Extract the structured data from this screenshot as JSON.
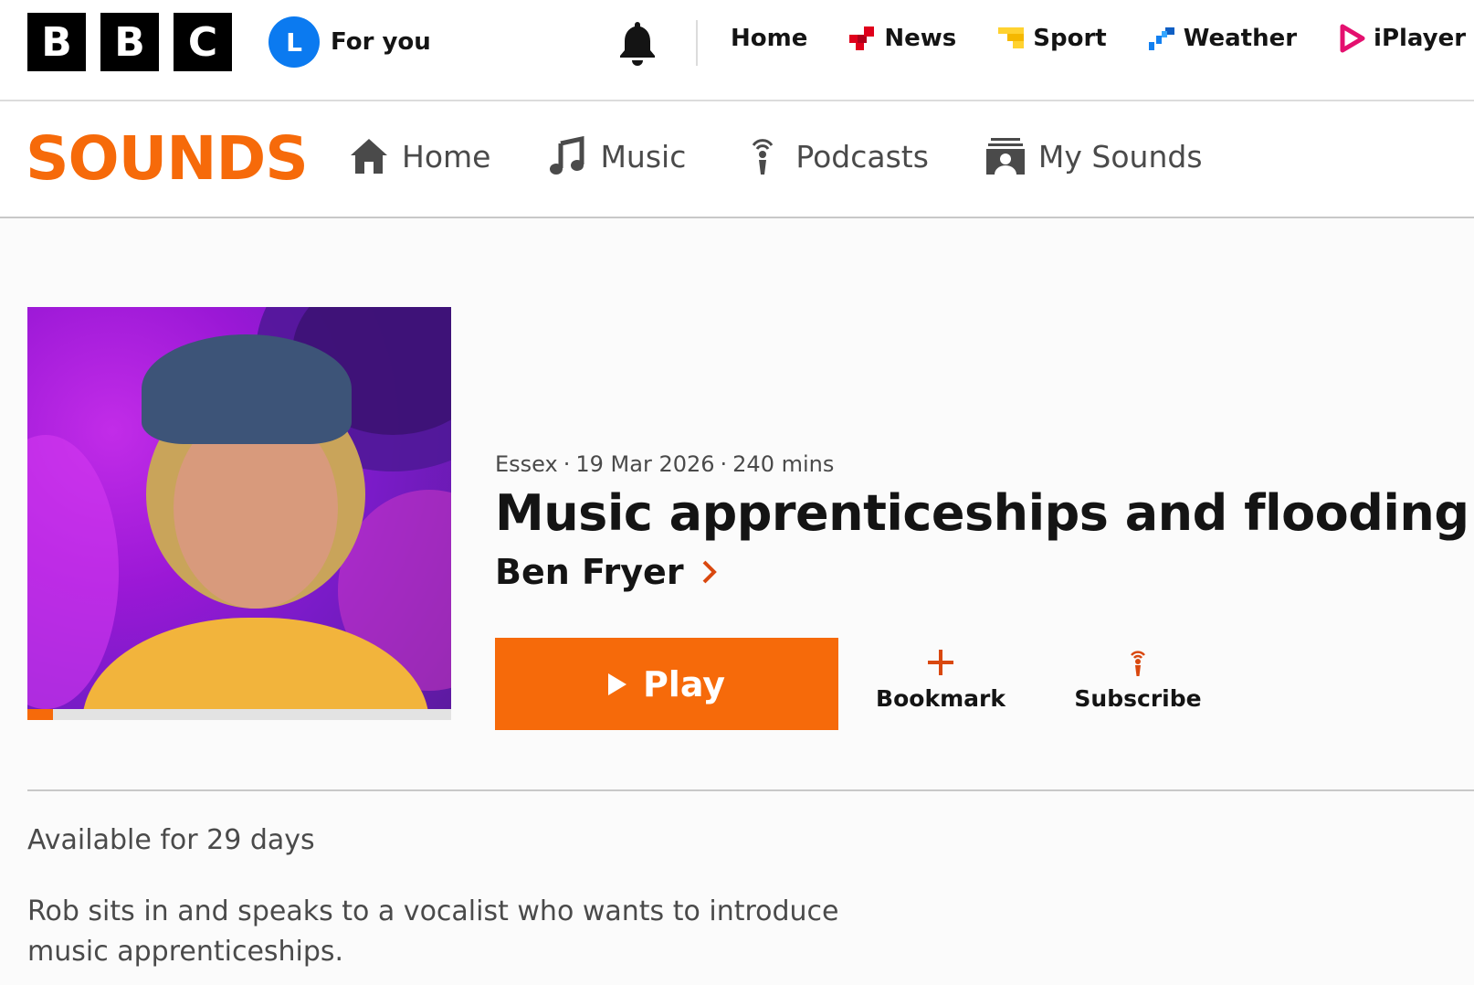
{
  "masthead": {
    "logo_letters": [
      "B",
      "B",
      "C"
    ],
    "account": {
      "initial": "L",
      "label": "For you",
      "avatar_color": "#0b7af0"
    },
    "notifications_icon": "bell-icon",
    "nav": [
      {
        "label": "Home",
        "icon": ""
      },
      {
        "label": "News",
        "icon": "news-icon",
        "color": "#e0001b"
      },
      {
        "label": "Sport",
        "icon": "sport-icon",
        "color": "#ffd230"
      },
      {
        "label": "Weather",
        "icon": "weather-icon",
        "color": "#1380f0"
      },
      {
        "label": "iPlayer",
        "icon": "iplayer-icon",
        "color": "#e4106f"
      }
    ]
  },
  "sounds_nav": {
    "brand": "SOUNDS",
    "brand_color": "#f66a0a",
    "items": [
      {
        "label": "Home",
        "icon": "house-icon"
      },
      {
        "label": "Music",
        "icon": "music-note-icon"
      },
      {
        "label": "Podcasts",
        "icon": "podcast-icon"
      },
      {
        "label": "My Sounds",
        "icon": "my-sounds-icon"
      }
    ]
  },
  "episode": {
    "station": "Essex",
    "date": "19 Mar 2026",
    "duration": "240 mins",
    "separator": "·",
    "title": "Music apprenticeships and flooding",
    "presenter": "Ben Fryer",
    "progress_fraction": 0.06,
    "play_label": "Play",
    "bookmark_label": "Bookmark",
    "subscribe_label": "Subscribe",
    "availability": "Available for 29 days",
    "synopsis": "Rob sits in and speaks to a vocalist who wants to introduce music apprenticeships.",
    "accent_color": "#f66a0a"
  }
}
